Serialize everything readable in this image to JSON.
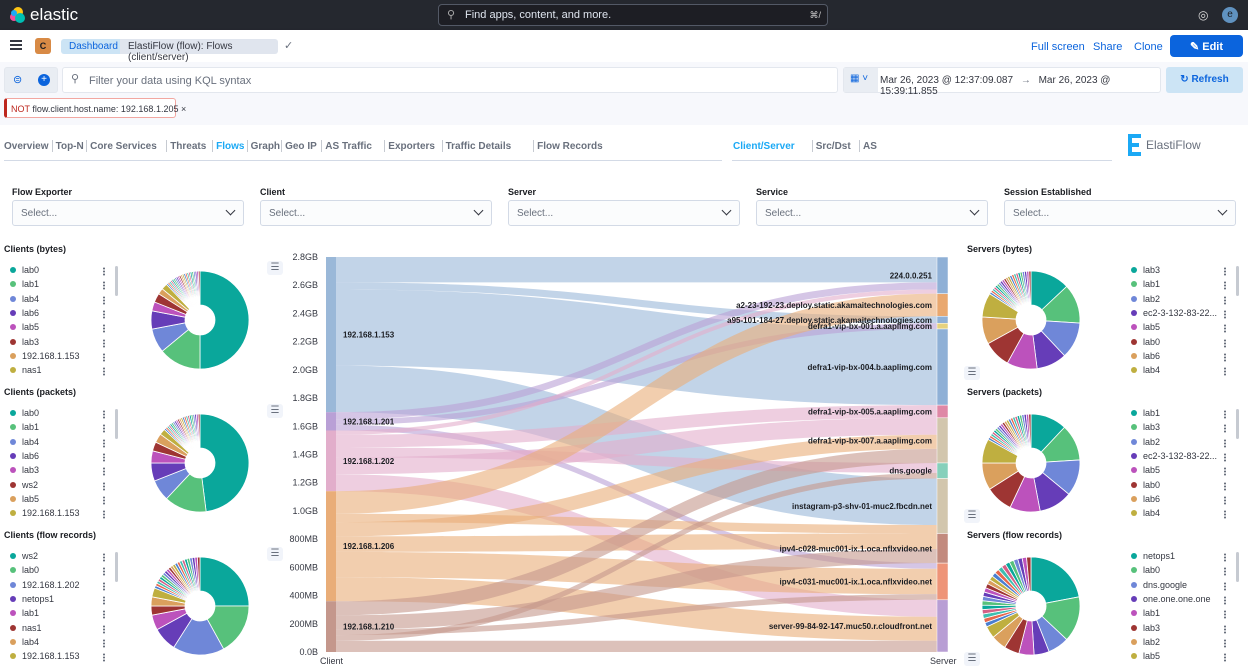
{
  "header": {
    "brand": "elastic",
    "search_placeholder": "Find apps, content, and more.",
    "search_shortcut": "⌘/",
    "avatar": "e"
  },
  "breadcrumb": {
    "space": "C",
    "items": [
      "Dashboard",
      "ElastiFlow (flow): Flows (client/server)"
    ]
  },
  "actions": {
    "full_screen": "Full screen",
    "share": "Share",
    "clone": "Clone",
    "edit": "Edit"
  },
  "query": {
    "placeholder": "Filter your data using KQL syntax",
    "time_start": "Mar 26, 2023 @ 12:37:09.087",
    "arrow": "→",
    "time_end": "Mar 26, 2023 @ 15:39:11.855",
    "refresh": "Refresh"
  },
  "filter_pill": {
    "negation": "NOT",
    "text": "flow.client.host.name: 192.168.1.205"
  },
  "nav": {
    "tabs": [
      "Overview",
      "Top-N",
      "Core Services",
      "Threats",
      "Flows",
      "Graph",
      "Geo IP",
      "AS Traffic",
      "Exporters",
      "Traffic Details",
      "Flow Records"
    ],
    "active": "Flows",
    "subtabs": [
      "Client/Server",
      "Src/Dst",
      "AS"
    ],
    "active_sub": "Client/Server",
    "logo": "ElastiFlow"
  },
  "controls": [
    {
      "label": "Flow Exporter",
      "placeholder": "Select..."
    },
    {
      "label": "Client",
      "placeholder": "Select..."
    },
    {
      "label": "Server",
      "placeholder": "Select..."
    },
    {
      "label": "Service",
      "placeholder": "Select..."
    },
    {
      "label": "Session Established",
      "placeholder": "Select..."
    }
  ],
  "colors": {
    "accent": "#0b64dd",
    "active_tab": "#1ba9f5",
    "palette": [
      "#0aa79b",
      "#57c17b",
      "#6f87d8",
      "#663db8",
      "#bc52bc",
      "#9e3533",
      "#daa05d",
      "#bfaf40",
      "#4a7fd0",
      "#e7664c",
      "#3ebeb0",
      "#d36086"
    ]
  },
  "pies": [
    {
      "title": "Clients (bytes)",
      "items": [
        [
          "lab0",
          50
        ],
        [
          "lab1",
          14
        ],
        [
          "lab4",
          8
        ],
        [
          "lab6",
          6
        ],
        [
          "lab5",
          3
        ],
        [
          "lab3",
          3
        ],
        [
          "192.168.1.153",
          2
        ],
        [
          "nas1",
          2
        ]
      ],
      "other_share": 12
    },
    {
      "title": "Clients (packets)",
      "items": [
        [
          "lab0",
          48
        ],
        [
          "lab1",
          14
        ],
        [
          "lab4",
          7
        ],
        [
          "lab6",
          6
        ],
        [
          "lab3",
          4
        ],
        [
          "ws2",
          3
        ],
        [
          "lab5",
          3
        ],
        [
          "192.168.1.153",
          2
        ]
      ],
      "other_share": 13
    },
    {
      "title": "Clients (flow records)",
      "items": [
        [
          "ws2",
          25
        ],
        [
          "lab0",
          17
        ],
        [
          "192.168.1.202",
          17
        ],
        [
          "netops1",
          8
        ],
        [
          "lab1",
          5
        ],
        [
          "nas1",
          3
        ],
        [
          "lab4",
          3
        ],
        [
          "192.168.1.153",
          3
        ]
      ],
      "other_share": 19
    },
    {
      "title": "Servers (bytes)",
      "items": [
        [
          "lab3",
          13
        ],
        [
          "lab1",
          13
        ],
        [
          "lab2",
          12
        ],
        [
          "ec2-3-132-83-22...",
          10
        ],
        [
          "lab5",
          10
        ],
        [
          "lab0",
          9
        ],
        [
          "lab6",
          9
        ],
        [
          "lab4",
          8
        ]
      ],
      "other_share": 16
    },
    {
      "title": "Servers (packets)",
      "items": [
        [
          "lab1",
          12
        ],
        [
          "lab3",
          12
        ],
        [
          "lab2",
          12
        ],
        [
          "ec2-3-132-83-22...",
          11
        ],
        [
          "lab5",
          10
        ],
        [
          "lab0",
          9
        ],
        [
          "lab6",
          9
        ],
        [
          "lab4",
          8
        ]
      ],
      "other_share": 17
    },
    {
      "title": "Servers (flow records)",
      "items": [
        [
          "netops1",
          22
        ],
        [
          "lab0",
          15
        ],
        [
          "dns.google",
          7
        ],
        [
          "one.one.one.one",
          5
        ],
        [
          "lab1",
          5
        ],
        [
          "lab3",
          5
        ],
        [
          "lab2",
          5
        ],
        [
          "lab5",
          4
        ]
      ],
      "other_share": 32
    }
  ],
  "chart_data": {
    "type": "sankey",
    "xlabels": [
      "Client",
      "Server"
    ],
    "unit": "GB",
    "ylim": [
      0,
      2.8
    ],
    "yticks": [
      "0.0B",
      "200MB",
      "400MB",
      "600MB",
      "800MB",
      "1.0GB",
      "1.2GB",
      "1.4GB",
      "1.6GB",
      "1.8GB",
      "2.0GB",
      "2.2GB",
      "2.4GB",
      "2.6GB",
      "2.8GB"
    ],
    "clients": [
      {
        "name": "192.168.1.153",
        "color": "#9ab8d8"
      },
      {
        "name": "192.168.1.201",
        "color": "#b9a0d6"
      },
      {
        "name": "192.168.1.202",
        "color": "#e2aecb"
      },
      {
        "name": "192.168.1.206",
        "color": "#e9ad78"
      },
      {
        "name": "192.168.1.210",
        "color": "#c4978c"
      }
    ],
    "servers": [
      {
        "name": "224.0.0.251",
        "color": "#8fb0d6"
      },
      {
        "name": "a2-23-192-23.deploy.static.akamaitechnologies.com",
        "color": "#e9a86f"
      },
      {
        "name": "a95-101-184-27.deploy.static.akamaitechnologies.com",
        "color": "#8fb0d6"
      },
      {
        "name": "defra1-vip-bx-001.a.aaplimg.com",
        "color": "#e6d27e"
      },
      {
        "name": "defra1-vip-bx-004.b.aaplimg.com",
        "color": "#8fb0d6"
      },
      {
        "name": "defra1-vip-bx-005.a.aaplimg.com",
        "color": "#df88a6"
      },
      {
        "name": "defra1-vip-bx-007.a.aaplimg.com",
        "color": "#d2c6ad"
      },
      {
        "name": "dns.google",
        "color": "#86d0bb"
      },
      {
        "name": "instagram-p3-shv-01-muc2.fbcdn.net",
        "color": "#d2c6ad"
      },
      {
        "name": "ipv4-c028-muc001-ix.1.oca.nflxvideo.net",
        "color": "#c28a7e"
      },
      {
        "name": "ipv4-c031-muc001-ix.1.oca.nflxvideo.net",
        "color": "#ee9478"
      },
      {
        "name": "server-99-84-92-147.muc50.r.cloudfront.net",
        "color": "#b89ed4"
      }
    ],
    "links": [
      [
        0,
        0,
        0.18
      ],
      [
        0,
        2,
        0.05
      ],
      [
        0,
        4,
        0.54
      ],
      [
        0,
        8,
        0.33
      ],
      [
        1,
        0,
        0.05
      ],
      [
        1,
        3,
        0.04
      ],
      [
        1,
        10,
        0.04
      ],
      [
        2,
        0,
        0.03
      ],
      [
        2,
        5,
        0.09
      ],
      [
        2,
        7,
        0.07
      ],
      [
        2,
        6,
        0.12
      ],
      [
        2,
        11,
        0.12
      ],
      [
        3,
        1,
        0.16
      ],
      [
        3,
        8,
        0.06
      ],
      [
        3,
        6,
        0.1
      ],
      [
        3,
        9,
        0.11
      ],
      [
        3,
        10,
        0.18
      ],
      [
        3,
        11,
        0.17
      ],
      [
        4,
        6,
        0.1
      ],
      [
        4,
        9,
        0.1
      ],
      [
        4,
        10,
        0.04
      ],
      [
        4,
        7,
        0.04
      ],
      [
        4,
        11,
        0.08
      ]
    ]
  }
}
